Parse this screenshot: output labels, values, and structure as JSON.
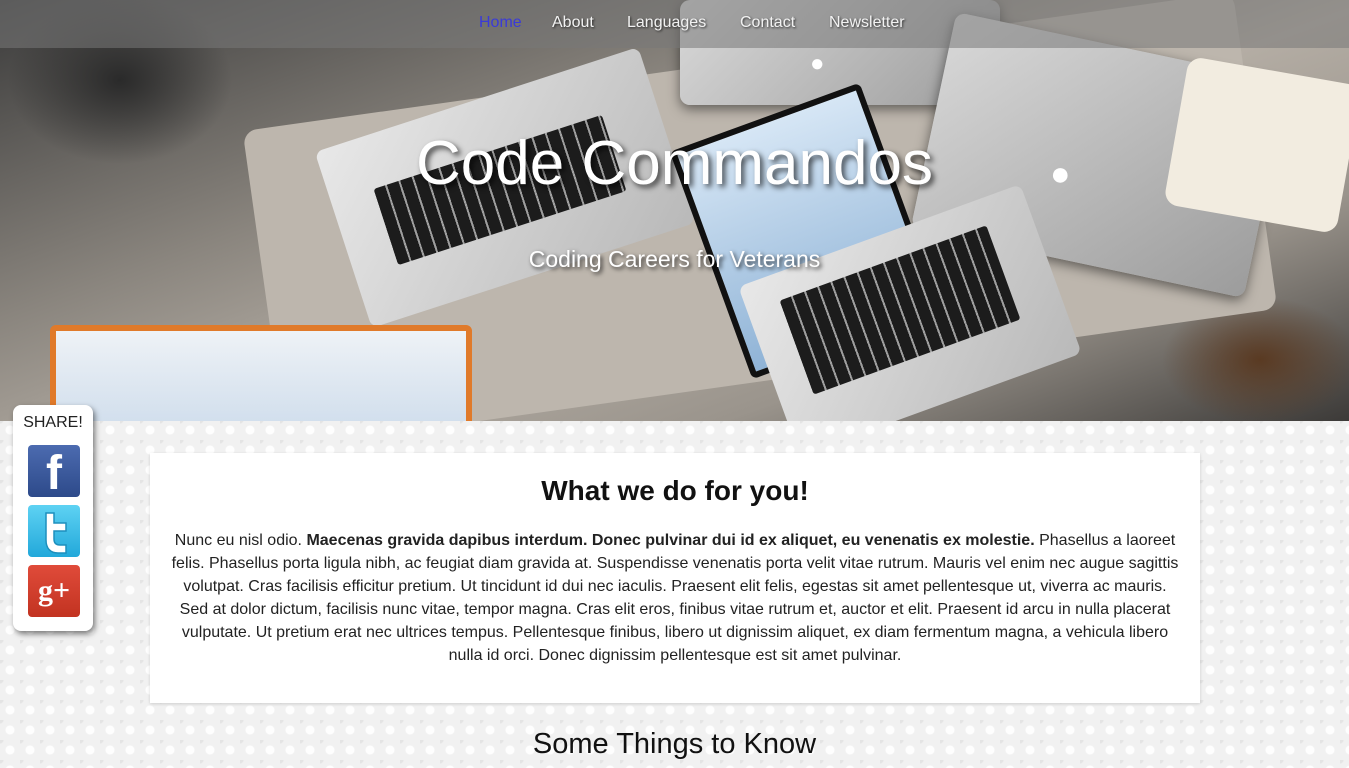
{
  "nav": {
    "items": [
      {
        "label": "Home",
        "active": true
      },
      {
        "label": "About"
      },
      {
        "label": "Languages"
      },
      {
        "label": "Contact"
      },
      {
        "label": "Newsletter"
      }
    ]
  },
  "hero": {
    "title": "Code Commandos",
    "subtitle": "Coding Careers for Veterans"
  },
  "share": {
    "label": "SHARE!",
    "buttons": [
      {
        "icon": "facebook-icon",
        "glyph": "f"
      },
      {
        "icon": "twitter-icon",
        "glyph": "t"
      },
      {
        "icon": "google-plus-icon",
        "glyph": "g+"
      }
    ]
  },
  "main": {
    "title": "What we do for you!",
    "body_lead": "Nunc eu nisl odio.",
    "body_bold": "Maecenas gravida dapibus interdum. Donec pulvinar dui id ex aliquet, eu venenatis ex molestie.",
    "body_rest": "Phasellus a laoreet felis. Phasellus porta ligula nibh, ac feugiat diam gravida at. Suspendisse venenatis porta velit vitae rutrum. Mauris vel enim nec augue sagittis volutpat. Cras facilisis efficitur pretium. Ut tincidunt id dui nec iaculis. Praesent elit felis, egestas sit amet pellentesque ut, viverra ac mauris. Sed at dolor dictum, facilisis nunc vitae, tempor magna. Cras elit eros, finibus vitae rutrum et, auctor et elit. Praesent id arcu in nulla placerat vulputate. Ut pretium erat nec ultrices tempus. Pellentesque finibus, libero ut dignissim aliquet, ex diam fermentum magna, a vehicula libero nulla id orci. Donec dignissim pellentesque est sit amet pulvinar."
  },
  "section2": {
    "title": "Some Things to Know"
  },
  "colors": {
    "nav_active": "#3a3ad8",
    "facebook": "#3b5998",
    "twitter": "#33b5e5",
    "google_plus": "#d23f31"
  }
}
